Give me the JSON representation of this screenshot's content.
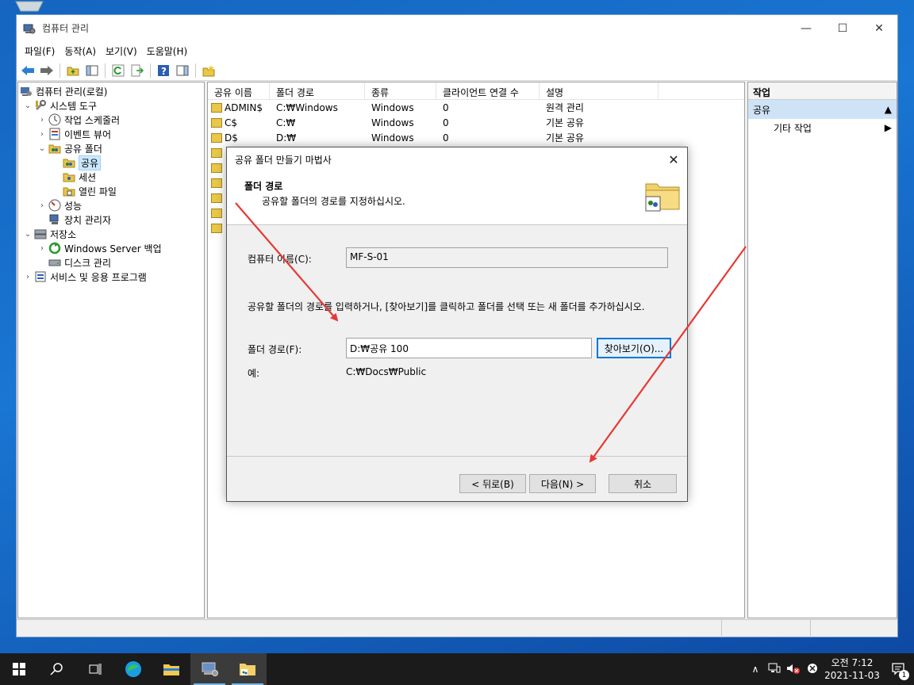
{
  "window": {
    "title": "컴퓨터 관리",
    "controls": {
      "minimize": "—",
      "maximize": "☐",
      "close": "✕"
    }
  },
  "menu": [
    "파일(F)",
    "동작(A)",
    "보기(V)",
    "도움말(H)"
  ],
  "tree": {
    "root": "컴퓨터 관리(로컬)",
    "system_tools": "시스템 도구",
    "task_scheduler": "작업 스케줄러",
    "event_viewer": "이벤트 뷰어",
    "shared_folders": "공유 폴더",
    "shares": "공유",
    "sessions": "세션",
    "open_files": "열린 파일",
    "performance": "성능",
    "device_manager": "장치 관리자",
    "storage": "저장소",
    "wsb": "Windows Server 백업",
    "disk_mgmt": "디스크 관리",
    "services": "서비스 및 응용 프로그램"
  },
  "list": {
    "headers": [
      "공유 이름",
      "폴더 경로",
      "종류",
      "클라이언트 연결 수",
      "설명"
    ],
    "rows": [
      [
        "ADMIN$",
        "C:₩Windows",
        "Windows",
        "0",
        "원격 관리"
      ],
      [
        "C$",
        "C:₩",
        "Windows",
        "0",
        "기본 공유"
      ],
      [
        "D$",
        "D:₩",
        "Windows",
        "0",
        "기본 공유"
      ]
    ]
  },
  "actions": {
    "header": "작업",
    "section": "공유",
    "item": "기타 작업"
  },
  "dialog": {
    "title": "공유 폴더 만들기 마법사",
    "heading": "폴더 경로",
    "subheading": "공유할 폴더의 경로를 지정하십시오.",
    "computer_label": "컴퓨터 이름(C):",
    "computer_value": "MF-S-01",
    "instruction": "공유할 폴더의 경로를 입력하거나, [찾아보기]를 클릭하고 폴더를 선택 또는 새 폴더를 추가하십시오.",
    "path_label": "폴더 경로(F):",
    "path_value": "D:₩공유 100",
    "browse": "찾아보기(O)...",
    "example_label": "예:",
    "example_value": "C:₩Docs₩Public",
    "back": "< 뒤로(B)",
    "next": "다음(N) >",
    "cancel": "취소",
    "close": "✕"
  },
  "taskbar": {
    "time": "오전 7:12",
    "date": "2021-11-03",
    "notif_count": "1"
  },
  "colors": {
    "accent": "#0078d7",
    "arrow": "#e53935",
    "selection": "#cce8ff",
    "taskbar": "#1b1b1b"
  }
}
